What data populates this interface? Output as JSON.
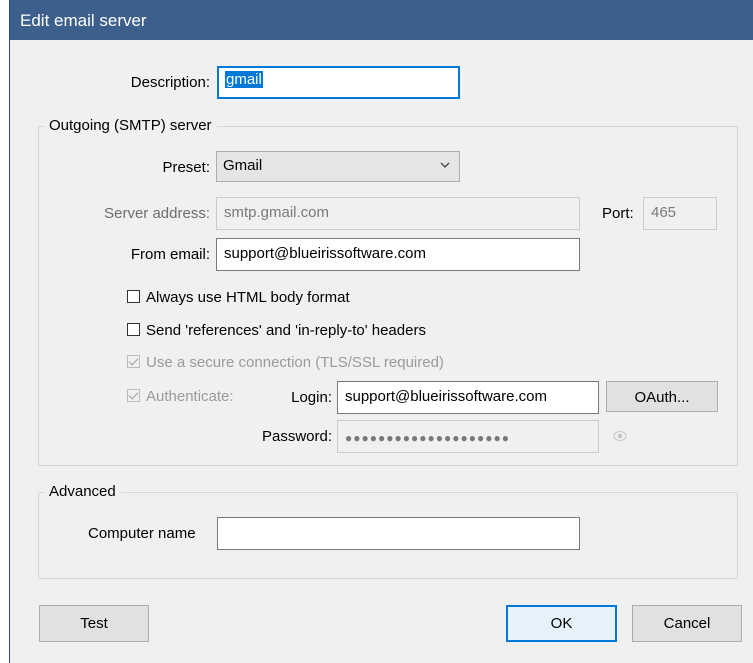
{
  "window": {
    "title": "Edit email server"
  },
  "description": {
    "label": "Description:",
    "value": "gmail"
  },
  "smtp": {
    "group_label": "Outgoing (SMTP) server"
  },
  "preset": {
    "label": "Preset:",
    "value": "Gmail",
    "icon": "chevron-down-icon"
  },
  "server": {
    "label": "Server address:",
    "value": "smtp.gmail.com"
  },
  "port": {
    "label": "Port:",
    "value": "465"
  },
  "from": {
    "label": "From email:",
    "value": "support@blueirissoftware.com"
  },
  "options": {
    "html_body": "Always use HTML body format",
    "references": "Send 'references' and 'in-reply-to' headers",
    "secure": "Use a secure connection (TLS/SSL required)",
    "authenticate": "Authenticate:"
  },
  "login": {
    "label": "Login:",
    "value": "support@blueirissoftware.com"
  },
  "oauth": {
    "label": "OAuth..."
  },
  "password": {
    "label": "Password:",
    "value": "●●●●●●●●●●●●●●●●●●●●",
    "icon": "eye-icon"
  },
  "advanced": {
    "group_label": "Advanced",
    "computer_label": "Computer name",
    "computer_value": ""
  },
  "buttons": {
    "test": "Test",
    "ok": "OK",
    "cancel": "Cancel"
  },
  "colors": {
    "title_bar": "#3d5f8c",
    "accent": "#0078d7"
  }
}
